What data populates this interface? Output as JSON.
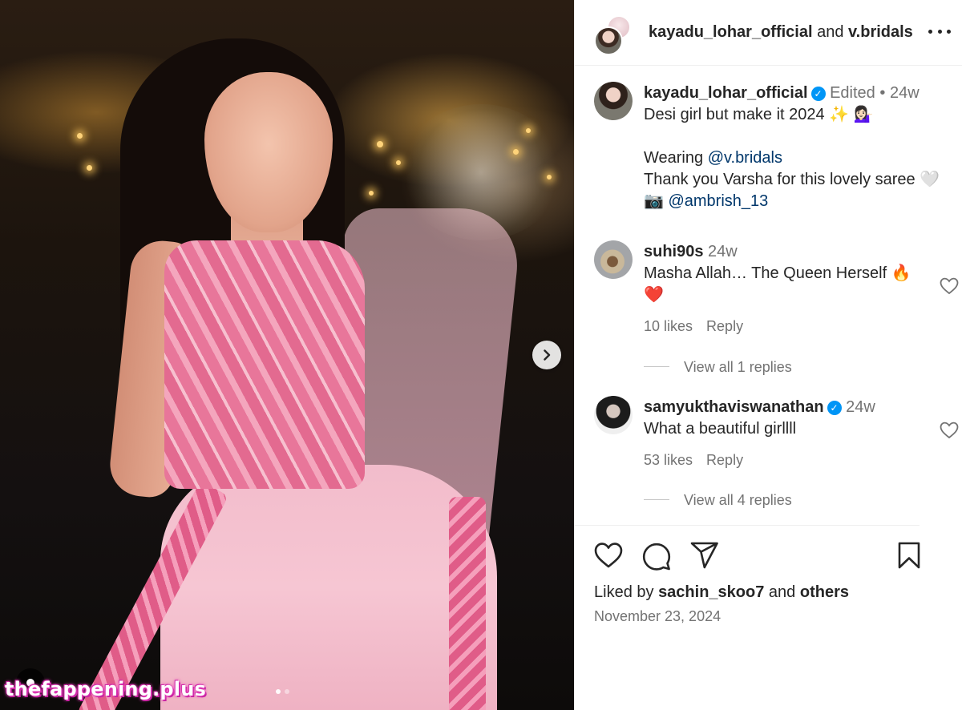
{
  "post": {
    "header": {
      "author": "kayadu_lohar_official",
      "joiner": "and",
      "collaborator": "v.bridals"
    },
    "caption": {
      "username": "kayadu_lohar_official",
      "edited": "Edited",
      "separator": "•",
      "age": "24w",
      "line1": "Desi girl but make it 2024",
      "line1_emoji": "✨ 💁🏻‍♀️",
      "wearing": "Wearing",
      "wearing_mention": "@v.bridals",
      "thanks": "Thank you Varsha for this lovely saree",
      "thanks_emoji": "🤍",
      "camera_emoji": "📷",
      "photo_mention": "@ambrish_13"
    },
    "comments": [
      {
        "username": "suhi90s",
        "age": "24w",
        "text": "Masha Allah… The Queen Herself",
        "emoji": "🔥",
        "emoji_line2": "❤️",
        "likes": "10 likes",
        "reply": "Reply",
        "view_replies": "View all 1 replies"
      },
      {
        "username": "samyukthaviswanathan",
        "age": "24w",
        "text": "What a beautiful girllll",
        "likes": "53 likes",
        "reply": "Reply",
        "view_replies": "View all 4 replies"
      }
    ],
    "liked_by": {
      "prefix": "Liked by",
      "user": "sachin_skoo7",
      "joiner": "and",
      "others": "others"
    },
    "date": "November 23, 2024",
    "carousel": {
      "current": 1,
      "total": 2
    }
  },
  "watermark": "thefappening.plus",
  "icons": [
    "more-icon",
    "verified-icon",
    "like-icon",
    "comment-icon",
    "share-icon",
    "save-icon",
    "next-arrow-icon",
    "comment-heart-icon"
  ],
  "colors": {
    "link": "#00376b",
    "verified": "#0095f6",
    "muted": "#737373",
    "heart": "#ed4956"
  }
}
